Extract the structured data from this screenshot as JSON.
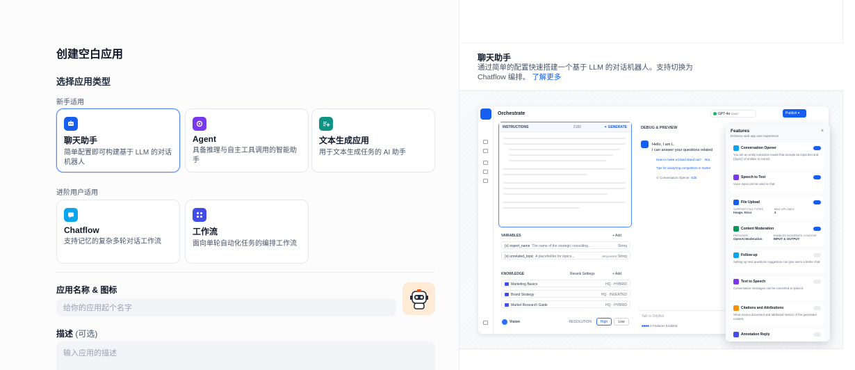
{
  "left": {
    "title": "创建空白应用",
    "section_title": "选择应用类型",
    "beginner_label": "新手适用",
    "advanced_label": "进阶用户适用",
    "cards": [
      {
        "title": "聊天助手",
        "desc": "简单配置即可构建基于 LLM 的对话机器人",
        "color": "#155eef"
      },
      {
        "title": "Agent",
        "desc": "具备推理与自主工具调用的智能助手",
        "color": "#7839ee"
      },
      {
        "title": "文本生成应用",
        "desc": "用于文本生成任务的 AI 助手",
        "color": "#0e9384"
      },
      {
        "title": "Chatflow",
        "desc": "支持记忆的复杂多轮对话工作流",
        "color": "#0ba5ec"
      },
      {
        "title": "工作流",
        "desc": "面向单轮自动化任务的编排工作流",
        "color": "#444ce7"
      }
    ],
    "name_label": "应用名称 & 图标",
    "name_placeholder": "给你的应用起个名字",
    "desc_label": "描述",
    "desc_optional": "(可选)",
    "desc_placeholder": "输入应用的描述"
  },
  "right": {
    "title": "聊天助手",
    "desc": "通过简单的配置快速搭建一个基于 LLM 的对话机器人。支持切换为 Chatflow 编排。",
    "link": "了解更多",
    "mock": {
      "header": "Orchestrate",
      "model": "GPT-4o",
      "model_tag": "CHAT",
      "publish": "Publish",
      "instructions": "INSTRUCTIONS",
      "char_count": "2182",
      "generate": "GENERATE",
      "variables": "VARIABLES",
      "add": "Add",
      "vars": [
        {
          "key": "{x} expert_name",
          "desc": "The name of the strategic consulting...",
          "type": "String"
        },
        {
          "key": "{x} unrelated_topic",
          "desc": "A placeholder for topics...",
          "type": "String",
          "req": "REQUIRED"
        }
      ],
      "knowledge": "KNOWLEDGE",
      "rerank": "Rerank Settings",
      "kb": [
        {
          "name": "Marketing Basics",
          "tag": "HQ · HYBRID"
        },
        {
          "name": "Brand Strategy",
          "tag": "HQ · INVERTED"
        },
        {
          "name": "Market Research Guide",
          "tag": "HQ · HYBRID"
        }
      ],
      "vision": "Vision",
      "resolution": "RESOLUTION",
      "high": "High",
      "low": "Low",
      "debug": "DEBUG & PREVIEW",
      "hello1": "Hello, I am L.",
      "hello2": "I can answer your questions related",
      "sugg1": "How to make a brand stand out?",
      "sugg1b": "Bra",
      "sugg2": "Tips for analyzing competitors in marke",
      "opener": "Conversation Opener",
      "edit": "Edit",
      "talk": "Talk to DifyBot",
      "enabled": "4 Features Enabled",
      "features": {
        "title": "Features",
        "sub": "Enhance web app user experience",
        "close": "×",
        "items": [
          {
            "t": "Conversation Opener",
            "d": "You are an entity extraction model that accepts an input text and {{type}} of entities to extract.",
            "color": "#0ba5ec",
            "on": true
          },
          {
            "t": "Speech to Text",
            "d": "Voice input can be used in chat.",
            "color": "#7839ee",
            "on": true
          },
          {
            "t": "File Upload",
            "d": "",
            "color": "#155eef",
            "on": true,
            "k1": "SUPPORT FILE TYPES",
            "v1": "Image, Docs",
            "k2": "MAX UPLOADS",
            "v2": "3"
          },
          {
            "t": "Content Moderation",
            "d": "",
            "color": "#079455",
            "on": true,
            "k1": "PROVIDER",
            "v1": "OpenAI Moderation",
            "k2": "ENABLED MODERATE CONTENT",
            "v2": "INPUT & OUTPUT"
          },
          {
            "t": "Follow-up",
            "d": "Setting up next questions suggestion can give users a better chat.",
            "color": "#0ba5ec",
            "on": false
          },
          {
            "t": "Text to Speech",
            "d": "Conversation messages can be converted to speech.",
            "color": "#7839ee",
            "on": false
          },
          {
            "t": "Citations and Attributions",
            "d": "Show source document and attributed section of the generated content.",
            "color": "#f79009",
            "on": false
          },
          {
            "t": "Annotation Reply",
            "d": "",
            "color": "#444ce7",
            "on": false
          }
        ]
      }
    }
  }
}
